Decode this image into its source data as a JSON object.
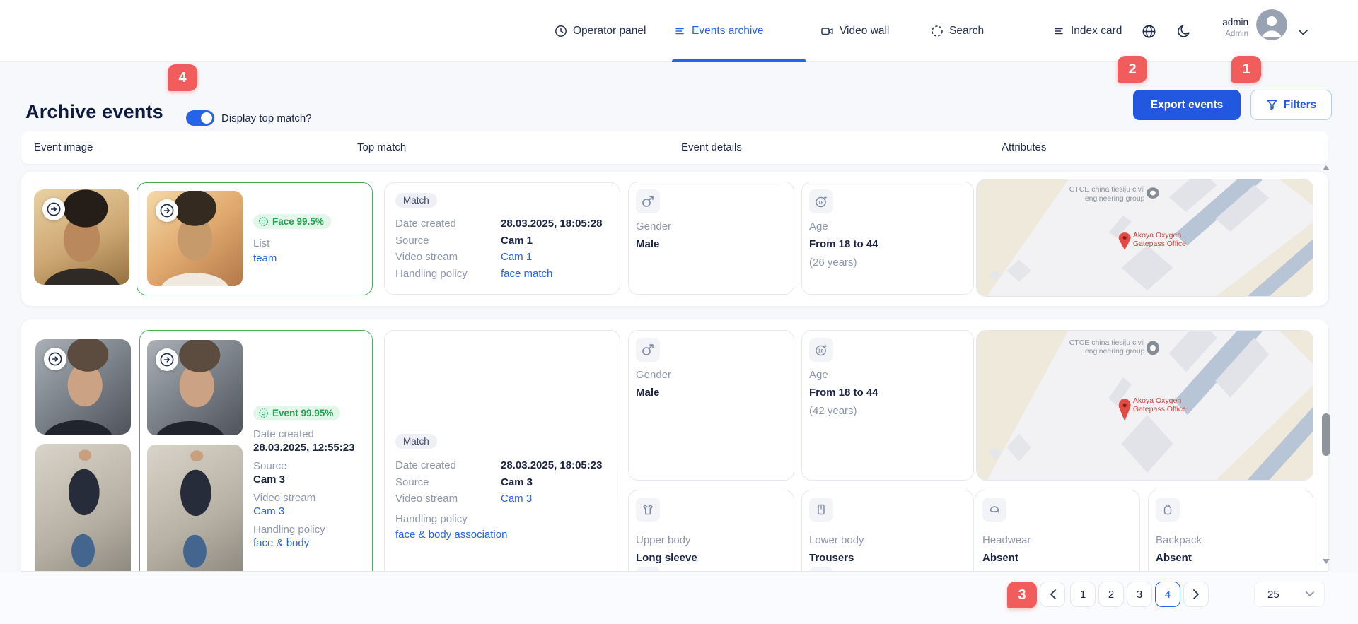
{
  "nav": {
    "operator_panel": "Operator panel",
    "events_archive": "Events archive",
    "video_wall": "Video wall",
    "search": "Search",
    "index_card": "Index card",
    "user_name": "admin",
    "user_role": "Admin"
  },
  "header": {
    "title": "Archive events",
    "toggle_label": "Display top match?",
    "export_button": "Export events",
    "filters_button": "Filters"
  },
  "annotations": {
    "n1": "1",
    "n2": "2",
    "n3": "3",
    "n4": "4"
  },
  "table_headers": {
    "col1": "Event image",
    "col2": "Top match",
    "col3": "Event details",
    "col4": "Attributes"
  },
  "row1": {
    "top_match": {
      "badge": "Face 99.5%",
      "list_label": "List",
      "list_link": "team"
    },
    "match": {
      "pill": "Match",
      "f1_label": "Date created",
      "f1_value": "28.03.2025, 18:05:28",
      "f2_label": "Source",
      "f2_value": "Cam 1",
      "f3_label": "Video stream",
      "f3_value": "Cam 1",
      "f4_label": "Handling policy",
      "f4_value": "face match"
    },
    "gender": {
      "label": "Gender",
      "value": "Male"
    },
    "age": {
      "label": "Age",
      "value": "From 18 to 44",
      "note": "(26 years)"
    }
  },
  "row2": {
    "event": {
      "badge": "Event 99.95%",
      "f1_label": "Date created",
      "f1_value": "28.03.2025, 12:55:23",
      "f2_label": "Source",
      "f2_value": "Cam 3",
      "f3_label": "Video stream",
      "f3_value": "Cam 3",
      "f4_label": "Handling policy",
      "f4_value": "face & body"
    },
    "match": {
      "pill": "Match",
      "f1_label": "Date created",
      "f1_value": "28.03.2025, 18:05:23",
      "f2_label": "Source",
      "f2_value": "Cam 3",
      "f3_label": "Video stream",
      "f3_value": "Cam 3",
      "f4_label": "Handling policy",
      "f4_value": "face & body association"
    },
    "gender": {
      "label": "Gender",
      "value": "Male"
    },
    "age": {
      "label": "Age",
      "value": "From 18 to 44",
      "note": "(42 years)"
    },
    "attr1": {
      "label": "Upper body",
      "value": "Long sleeve"
    },
    "attr2": {
      "label": "Lower body",
      "value": "Trousers"
    },
    "attr3": {
      "label": "Headwear",
      "value": "Absent"
    },
    "attr4": {
      "label": "Backpack",
      "value": "Absent"
    }
  },
  "map": {
    "place1_line1": "CTCE china tiesiju civil",
    "place1_line2": "engineering group",
    "place2_line1": "Akoya Oxygen",
    "place2_line2": "Gatepass Office"
  },
  "pagination": {
    "p1": "1",
    "p2": "2",
    "p3": "3",
    "p4": "4",
    "page_size": "25"
  }
}
